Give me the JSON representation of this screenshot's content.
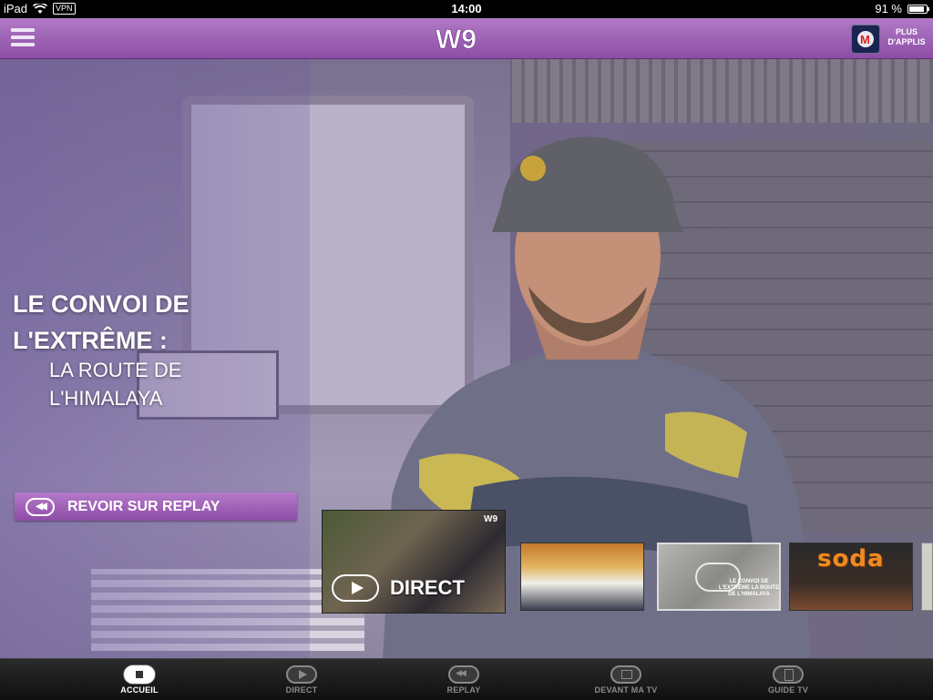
{
  "status_bar": {
    "device": "iPad",
    "vpn": "VPN",
    "time": "14:00",
    "battery_text": "91 %",
    "battery_level": 0.91
  },
  "header": {
    "logo_text": "W9",
    "plus_applis": "PLUS D'APPLIS",
    "colors": {
      "bar_top": "#b17ac5",
      "bar_bottom": "#8c4ea6"
    }
  },
  "hero": {
    "title": "LE CONVOI DE L'EXTRÊME :",
    "subtitle": "LA ROUTE DE L'HIMALAYA",
    "replay_button": "REVOIR SUR REPLAY"
  },
  "carousel": {
    "direct_label": "DIRECT",
    "direct_badge": "W9",
    "convoi_thumb_title": "LE CONVOI DE L'EXTRÊME LA ROUTE DE L'HIMALAYA",
    "soda_title": "soda"
  },
  "tabs": [
    {
      "label": "ACCUEIL",
      "icon": "home-icon",
      "active": true
    },
    {
      "label": "DIRECT",
      "icon": "play-icon",
      "active": false
    },
    {
      "label": "REPLAY",
      "icon": "rewind-icon",
      "active": false
    },
    {
      "label": "DEVANT MA TV",
      "icon": "tv-icon",
      "active": false
    },
    {
      "label": "GUIDE TV",
      "icon": "guide-icon",
      "active": false
    }
  ]
}
